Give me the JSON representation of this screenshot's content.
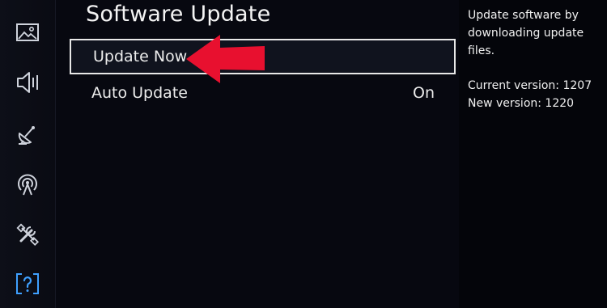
{
  "sidebar": {
    "items": [
      {
        "icon": "picture-icon"
      },
      {
        "icon": "sound-icon"
      },
      {
        "icon": "broadcasting-icon"
      },
      {
        "icon": "network-icon"
      },
      {
        "icon": "system-tools-icon"
      },
      {
        "icon": "support-help-icon"
      }
    ],
    "active_index": 5,
    "accent_color": "#3fa0ff"
  },
  "page": {
    "title": "Software Update"
  },
  "menu": {
    "items": [
      {
        "label": "Update Now",
        "value": "",
        "selected": true
      },
      {
        "label": "Auto Update",
        "value": "On",
        "selected": false
      }
    ]
  },
  "annotation": {
    "arrow_color": "#e8102f",
    "arrow_direction": "left",
    "target": "Update Now"
  },
  "info": {
    "description": "Update software by downloading update files.",
    "current_version": "Current version: 1207",
    "new_version": "New version: 1220"
  }
}
